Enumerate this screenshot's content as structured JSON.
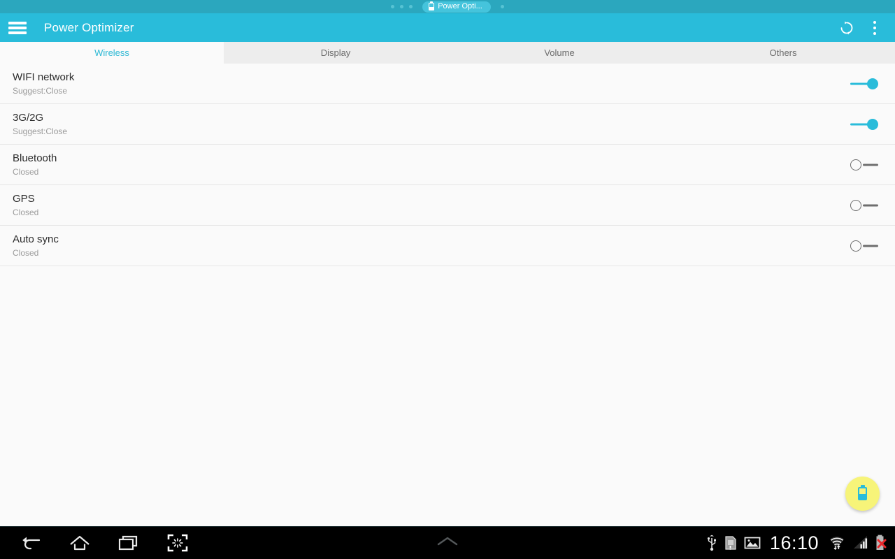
{
  "window_strip": {
    "tab_label": "Power Opti...",
    "tab_icon": "battery-icon",
    "left_dots": 3,
    "right_dots": 1,
    "background_color": "#2ba7be"
  },
  "appbar": {
    "menu_icon": "hamburger-icon",
    "title": "Power Optimizer",
    "refresh_icon": "refresh-icon",
    "overflow_icon": "overflow-menu-icon",
    "background_color": "#29bcda",
    "text_color": "#ffffff"
  },
  "tabs": {
    "active_color": "#2cb8d4",
    "inactive_color": "#6b6b6b",
    "items": [
      {
        "label": "Wireless",
        "active": true
      },
      {
        "label": "Display",
        "active": false
      },
      {
        "label": "Volume",
        "active": false
      },
      {
        "label": "Others",
        "active": false
      }
    ]
  },
  "list": {
    "rows": [
      {
        "title": "WIFI network",
        "subtitle": "Suggest:Close",
        "toggle": "on",
        "toggle_name": "toggle-wifi-network"
      },
      {
        "title": "3G/2G",
        "subtitle": "Suggest:Close",
        "toggle": "on",
        "toggle_name": "toggle-3g-2g"
      },
      {
        "title": "Bluetooth",
        "subtitle": "Closed",
        "toggle": "off",
        "toggle_name": "toggle-bluetooth"
      },
      {
        "title": "GPS",
        "subtitle": "Closed",
        "toggle": "off",
        "toggle_name": "toggle-gps"
      },
      {
        "title": "Auto sync",
        "subtitle": "Closed",
        "toggle": "off",
        "toggle_name": "toggle-auto-sync"
      }
    ],
    "toggle_on_color": "#29bcda",
    "toggle_off_color": "#6e6e6e",
    "background_color": "#fafafa"
  },
  "fab": {
    "icon": "battery-icon",
    "background_color": "#f7f479",
    "icon_color": "#29bcda"
  },
  "navbar": {
    "background_color": "#000000",
    "buttons": [
      {
        "icon": "back-icon"
      },
      {
        "icon": "home-icon"
      },
      {
        "icon": "recents-icon"
      },
      {
        "icon": "screenshot-icon"
      }
    ],
    "center_icon": "chevron-up-icon",
    "status": {
      "usb_icon": "usb-icon",
      "sim_icon": "sim-card-alert-icon",
      "image_icon": "image-icon",
      "time": "16:10",
      "wifi_icon": "wifi-signal-icon",
      "cellular_icon": "cellular-signal-icon",
      "battery_icon": "battery-error-icon"
    }
  }
}
